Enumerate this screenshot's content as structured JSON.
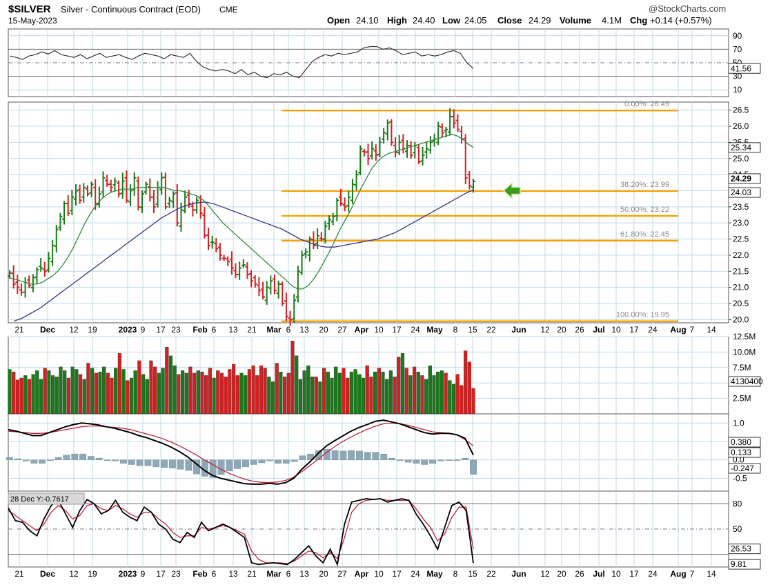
{
  "header": {
    "symbol": "$SILVER",
    "name": "Silver - Continuous Contract (EOD)",
    "exchange": "CME",
    "date": "15-May-2023",
    "brand": "@StockCharts.com",
    "open_label": "Open",
    "open": "24.10",
    "high_label": "High",
    "high": "24.40",
    "low_label": "Low",
    "low": "24.05",
    "close_label": "Close",
    "close": "24.29",
    "volume_label": "Volume",
    "volume": "4.1M",
    "chg_label": "Chg",
    "chg": "+0.14 (+0.57%)"
  },
  "colors": {
    "up": "#1a7a1a",
    "down": "#d42020",
    "fib": "#f5a000",
    "ma_short": "#2f8a3a",
    "ma_long": "#33338f",
    "grid": "#bfd8e6",
    "macd_line": "#000000",
    "signal_line": "#c0203c",
    "histogram": "#8fa8b8",
    "arrow": "#3a9a1a"
  },
  "x_axis_labels": [
    "21",
    "Dec",
    "12",
    "19",
    "2023",
    "9",
    "17",
    "23",
    "Feb",
    "6",
    "13",
    "21",
    "Mar",
    "6",
    "13",
    "20",
    "27",
    "Apr",
    "10",
    "17",
    "24",
    "May",
    "8",
    "15",
    "22",
    "Jun",
    "12",
    "20",
    "26",
    "Jul",
    "10",
    "17",
    "24",
    "Aug",
    "7",
    "14"
  ],
  "chart_data": [
    {
      "panel": "rsi",
      "type": "line",
      "title": "RSI",
      "y_ticks": [
        "90",
        "70",
        "50",
        "30",
        "10"
      ],
      "ylim": [
        0,
        100
      ],
      "current_value": "41.56",
      "values": [
        60,
        58,
        55,
        60,
        62,
        66,
        63,
        68,
        62,
        60,
        58,
        62,
        56,
        60,
        64,
        58,
        60,
        62,
        58,
        55,
        60,
        64,
        62,
        60,
        56,
        62,
        60,
        58,
        64,
        52,
        44,
        40,
        38,
        40,
        38,
        34,
        40,
        32,
        36,
        30,
        28,
        34,
        32,
        36,
        30,
        28,
        40,
        52,
        58,
        62,
        60,
        64,
        62,
        64,
        66,
        72,
        74,
        74,
        70,
        72,
        68,
        62,
        64,
        66,
        60,
        62,
        60,
        62,
        66,
        68,
        64,
        50,
        41.56
      ]
    },
    {
      "panel": "price",
      "type": "candlestick",
      "title": "$SILVER Silver - Continuous Contract (EOD)",
      "y_ticks": [
        "26.5",
        "26.0",
        "25.5",
        "25.0",
        "24.5",
        "24.0",
        "23.5",
        "23.0",
        "22.5",
        "22.0",
        "21.5",
        "21.0",
        "20.5",
        "20.0"
      ],
      "ylim": [
        19.9,
        26.75
      ],
      "last_close_label": "24.29",
      "ma_short_label": "25.34",
      "ma_long_label": "24.03",
      "fib_levels": [
        {
          "label": "0.00%: 26.49",
          "value": 26.49
        },
        {
          "label": "38.20%: 23.99",
          "value": 23.99
        },
        {
          "label": "50.00%: 23.22",
          "value": 23.22
        },
        {
          "label": "61.80%: 22.45",
          "value": 22.45
        },
        {
          "label": "100.00%: 19.95",
          "value": 19.95
        }
      ],
      "closes": [
        21.45,
        21.1,
        21.0,
        20.85,
        21.15,
        21.05,
        21.3,
        21.55,
        21.6,
        21.5,
        21.9,
        22.3,
        22.8,
        23.2,
        23.6,
        23.3,
        23.8,
        24.0,
        23.7,
        24.1,
        23.9,
        24.2,
        23.6,
        23.9,
        24.4,
        24.2,
        24.1,
        24.3,
        23.9,
        24.3,
        23.7,
        24.0,
        24.4,
        23.5,
        23.9,
        24.2,
        23.8,
        23.5,
        24.1,
        24.4,
        23.5,
        23.7,
        23.9,
        23.0,
        23.4,
        23.8,
        23.6,
        23.4,
        23.7,
        23.3,
        22.6,
        22.3,
        22.4,
        22.2,
        22.0,
        21.9,
        21.8,
        21.6,
        21.4,
        21.6,
        21.7,
        21.4,
        21.2,
        21.1,
        20.9,
        20.7,
        21.0,
        21.2,
        20.9,
        21.1,
        20.5,
        20.1,
        20.0,
        20.6,
        21.5,
        22.0,
        22.1,
        22.5,
        22.3,
        22.6,
        22.5,
        22.9,
        23.1,
        23.2,
        23.7,
        23.6,
        23.5,
        23.8,
        24.2,
        24.5,
        25.3,
        25.2,
        25.0,
        25.3,
        25.1,
        25.5,
        25.8,
        26.1,
        25.5,
        25.2,
        25.5,
        25.3,
        25.4,
        25.1,
        25.4,
        24.9,
        25.1,
        25.3,
        25.5,
        25.6,
        26.0,
        25.8,
        25.9,
        26.3,
        26.1,
        25.9,
        25.6,
        24.4,
        24.15,
        24.29
      ],
      "ma_short": [
        21.3,
        21.25,
        21.2,
        21.15,
        21.1,
        21.1,
        21.15,
        21.25,
        21.35,
        21.5,
        21.7,
        21.95,
        22.25,
        22.6,
        22.95,
        23.25,
        23.5,
        23.7,
        23.85,
        23.95,
        24.0,
        24.05,
        24.05,
        24.05,
        24.1,
        24.1,
        24.1,
        24.1,
        24.1,
        24.1,
        24.05,
        24.0,
        24.0,
        23.95,
        23.9,
        23.85,
        23.75,
        23.6,
        23.4,
        23.2,
        23.0,
        22.85,
        22.7,
        22.55,
        22.4,
        22.25,
        22.1,
        21.95,
        21.8,
        21.65,
        21.5,
        21.35,
        21.2,
        21.05,
        20.95,
        20.95,
        21.05,
        21.25,
        21.5,
        21.8,
        22.1,
        22.45,
        22.8,
        23.1,
        23.4,
        23.75,
        24.1,
        24.4,
        24.7,
        24.9,
        25.05,
        25.15,
        25.2,
        25.25,
        25.3,
        25.35,
        25.4,
        25.45,
        25.5,
        25.55,
        25.6,
        25.65,
        25.7,
        25.75,
        25.7,
        25.6,
        25.45,
        25.34
      ],
      "ma_long": [
        19.95,
        20.05,
        20.2,
        20.35,
        20.55,
        20.75,
        20.95,
        21.15,
        21.35,
        21.55,
        21.75,
        21.95,
        22.15,
        22.35,
        22.55,
        22.75,
        22.95,
        23.15,
        23.3,
        23.45,
        23.55,
        23.62,
        23.65,
        23.6,
        23.5,
        23.4,
        23.3,
        23.2,
        23.1,
        23.0,
        22.9,
        22.8,
        22.65,
        22.5,
        22.4,
        22.3,
        22.25,
        22.25,
        22.3,
        22.35,
        22.4,
        22.45,
        22.5,
        22.6,
        22.7,
        22.85,
        23.0,
        23.15,
        23.3,
        23.45,
        23.6,
        23.75,
        23.9,
        24.03
      ]
    },
    {
      "panel": "volume",
      "type": "bar",
      "title": "Volume",
      "y_ticks": [
        "12.5M",
        "10.0M",
        "7.5M",
        "5.0M",
        "2.5M"
      ],
      "ylim": [
        0,
        12500000
      ],
      "current_value": "4130400",
      "values": [
        7.2,
        6.8,
        5.5,
        5.8,
        6.2,
        5.6,
        6.4,
        7.0,
        5.6,
        7.4,
        7.0,
        6.2,
        6.0,
        7.6,
        7.0,
        5.8,
        7.6,
        7.2,
        6.4,
        5.6,
        8.2,
        7.4,
        6.6,
        6.8,
        7.6,
        6.6,
        5.8,
        7.4,
        9.8,
        7.2,
        5.4,
        5.8,
        7.0,
        8.6,
        6.4,
        5.6,
        8.6,
        7.6,
        6.6,
        7.4,
        10.8,
        9.4,
        7.8,
        6.4,
        7.0,
        6.6,
        7.6,
        6.6,
        7.0,
        6.8,
        6.2,
        7.4,
        5.8,
        7.0,
        6.6,
        6.0,
        7.2,
        8.0,
        6.2,
        6.6,
        6.2,
        7.2,
        7.8,
        6.2,
        7.8,
        7.4,
        6.0,
        5.2,
        8.2,
        6.8,
        6.0,
        6.6,
        11.8,
        9.4,
        5.6,
        7.0,
        7.8,
        6.0,
        6.0,
        5.2,
        7.4,
        6.8,
        5.8,
        7.6,
        6.6,
        7.4,
        5.8,
        6.8,
        7.2,
        6.4,
        5.8,
        7.8,
        6.0,
        6.8,
        7.4,
        6.8,
        5.6,
        7.0,
        6.0,
        9.2,
        9.8,
        7.4,
        6.2,
        7.6,
        6.8,
        6.2,
        5.6,
        7.8,
        6.2,
        6.8,
        7.0,
        6.6,
        5.4,
        4.8,
        6.4,
        4.6,
        10.2,
        8.4,
        4.13
      ],
      "up_down": "alternating by close vs previous close"
    },
    {
      "panel": "macd",
      "type": "line",
      "title": "MACD",
      "y_ticks": [
        "1.0",
        "0.5",
        "0.0",
        "-0.5"
      ],
      "ylim": [
        -0.85,
        1.25
      ],
      "macd_label": "0.133",
      "signal_label": "0.380",
      "histogram_label": "-0.247",
      "macd": [
        0.82,
        0.78,
        0.72,
        0.66,
        0.66,
        0.74,
        0.82,
        0.9,
        0.96,
        1.0,
        0.98,
        0.95,
        0.9,
        0.86,
        0.8,
        0.74,
        0.66,
        0.6,
        0.52,
        0.44,
        0.34,
        0.22,
        0.08,
        -0.1,
        -0.28,
        -0.42,
        -0.5,
        -0.55,
        -0.6,
        -0.65,
        -0.66,
        -0.66,
        -0.64,
        -0.66,
        -0.62,
        -0.5,
        -0.25,
        -0.05,
        0.18,
        0.38,
        0.52,
        0.65,
        0.78,
        0.88,
        0.96,
        1.05,
        1.08,
        1.03,
        0.98,
        0.9,
        0.82,
        0.74,
        0.7,
        0.72,
        0.72,
        0.68,
        0.58,
        0.133
      ],
      "signal": [
        0.78,
        0.76,
        0.74,
        0.72,
        0.72,
        0.74,
        0.78,
        0.82,
        0.86,
        0.9,
        0.92,
        0.92,
        0.9,
        0.88,
        0.86,
        0.82,
        0.76,
        0.7,
        0.64,
        0.57,
        0.48,
        0.38,
        0.26,
        0.14,
        0.0,
        -0.12,
        -0.25,
        -0.36,
        -0.45,
        -0.53,
        -0.58,
        -0.61,
        -0.62,
        -0.6,
        -0.56,
        -0.47,
        -0.32,
        -0.15,
        0.02,
        0.2,
        0.36,
        0.5,
        0.62,
        0.73,
        0.83,
        0.92,
        0.98,
        1.0,
        0.98,
        0.94,
        0.88,
        0.82,
        0.76,
        0.74,
        0.72,
        0.68,
        0.55,
        0.38
      ]
    },
    {
      "panel": "stochastic",
      "type": "line",
      "title": "Slow Stochastic",
      "annotation": "28 Dec Y:-0.7617",
      "y_ticks": [
        "80",
        "50",
        "20"
      ],
      "ylim": [
        5,
        95
      ],
      "k_label": "9.81",
      "d_label": "26.53",
      "k": [
        75,
        60,
        58,
        48,
        42,
        62,
        78,
        84,
        68,
        52,
        72,
        85,
        80,
        68,
        72,
        84,
        70,
        64,
        60,
        76,
        70,
        56,
        50,
        38,
        34,
        46,
        40,
        58,
        48,
        52,
        56,
        52,
        46,
        40,
        10,
        8,
        9,
        10,
        9,
        8,
        14,
        22,
        30,
        18,
        10,
        26,
        8,
        56,
        82,
        84,
        86,
        85,
        86,
        82,
        84,
        86,
        84,
        68,
        56,
        42,
        26,
        52,
        78,
        82,
        72,
        9.81
      ],
      "d": [
        72,
        66,
        60,
        54,
        48,
        56,
        70,
        78,
        72,
        62,
        66,
        78,
        80,
        74,
        72,
        78,
        74,
        68,
        64,
        70,
        70,
        62,
        56,
        46,
        40,
        42,
        42,
        52,
        50,
        52,
        54,
        52,
        48,
        44,
        24,
        14,
        10,
        10,
        10,
        9,
        12,
        18,
        24,
        22,
        16,
        22,
        15,
        40,
        70,
        80,
        84,
        85,
        86,
        84,
        84,
        84,
        84,
        74,
        62,
        52,
        36,
        44,
        64,
        76,
        76,
        26.53
      ]
    }
  ]
}
